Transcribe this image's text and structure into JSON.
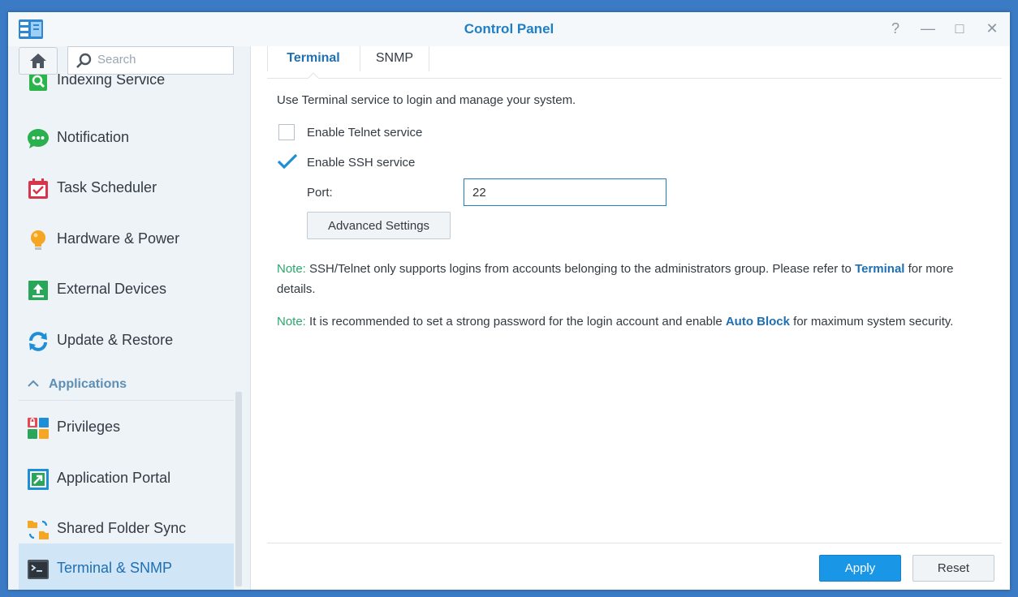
{
  "window": {
    "title": "Control Panel"
  },
  "titlebar": {
    "help_glyph": "?",
    "minimize_glyph": "—",
    "maximize_glyph": "□",
    "close_glyph": "✕"
  },
  "sidebar": {
    "search": {
      "placeholder": "Search"
    },
    "items": [
      {
        "label": "Indexing Service",
        "icon": "indexing-service-icon",
        "color": "#2ab44a"
      },
      {
        "label": "Notification",
        "icon": "notification-icon",
        "color": "#2bb04f"
      },
      {
        "label": "Task Scheduler",
        "icon": "task-scheduler-icon",
        "color": "#d9354a"
      },
      {
        "label": "Hardware & Power",
        "icon": "hardware-power-icon",
        "color": "#f5a623"
      },
      {
        "label": "External Devices",
        "icon": "external-devices-icon",
        "color": "#2aa65a"
      },
      {
        "label": "Update & Restore",
        "icon": "update-restore-icon",
        "color": "#1e8fd6"
      }
    ],
    "section": {
      "label": "Applications"
    },
    "app_items": [
      {
        "label": "Privileges",
        "icon": "privileges-icon"
      },
      {
        "label": "Application Portal",
        "icon": "application-portal-icon"
      },
      {
        "label": "Shared Folder Sync",
        "icon": "shared-folder-sync-icon"
      },
      {
        "label": "Terminal & SNMP",
        "icon": "terminal-icon",
        "active": true
      }
    ]
  },
  "tabs": [
    {
      "label": "Terminal",
      "active": true
    },
    {
      "label": "SNMP",
      "active": false
    }
  ],
  "terminal": {
    "description": "Use Terminal service to login and manage your system.",
    "telnet": {
      "label": "Enable Telnet service",
      "checked": false
    },
    "ssh": {
      "label": "Enable SSH service",
      "checked": true
    },
    "port": {
      "label": "Port:",
      "value": "22"
    },
    "advanced_button": "Advanced Settings",
    "note1": {
      "tag": "Note:",
      "text_before": " SSH/Telnet only supports logins from accounts belonging to the administrators group. Please refer to ",
      "link": "Terminal",
      "text_after": " for more details."
    },
    "note2": {
      "tag": "Note:",
      "text_before": " It is recommended to set a strong password for the login account and enable ",
      "link": "Auto Block",
      "text_after": " for maximum system security."
    }
  },
  "footer": {
    "apply": "Apply",
    "reset": "Reset"
  },
  "colors": {
    "accent": "#1f7fc6",
    "note_tag": "#2aa86a",
    "apply_bg": "#1996e6",
    "active_item_bg": "#d0e5f6"
  }
}
